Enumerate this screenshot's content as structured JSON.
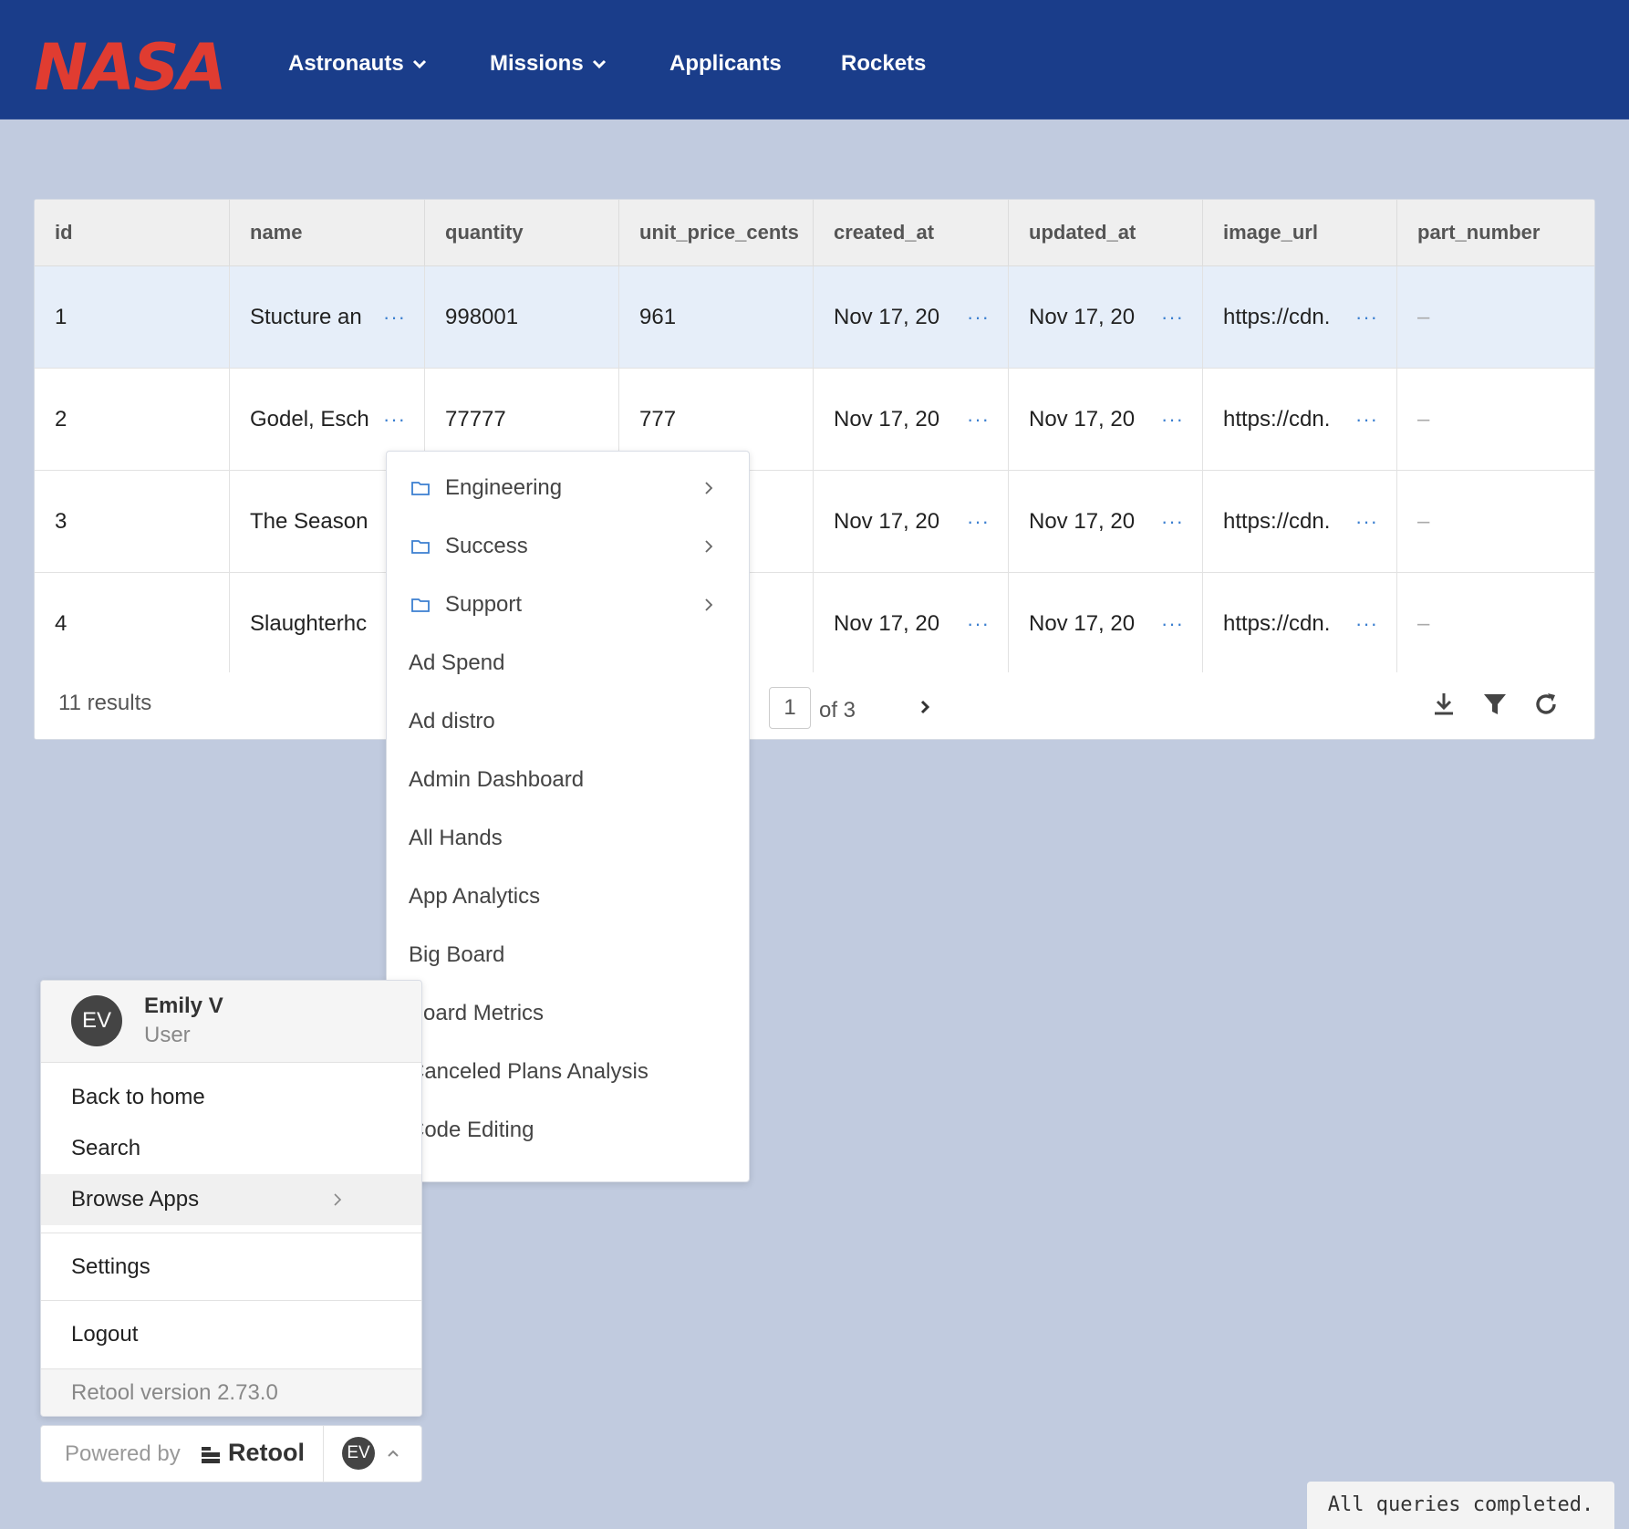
{
  "brand": {
    "logo_text": "NASA",
    "logo_color": "#e03c31",
    "nav_bg": "#1a3d8a"
  },
  "nav": {
    "items": [
      {
        "label": "Astronauts",
        "dropdown": true
      },
      {
        "label": "Missions",
        "dropdown": true
      },
      {
        "label": "Applicants",
        "dropdown": false
      },
      {
        "label": "Rockets",
        "dropdown": false
      }
    ]
  },
  "table": {
    "columns": [
      "id",
      "name",
      "quantity",
      "unit_price_cents",
      "created_at",
      "updated_at",
      "image_url",
      "part_number"
    ],
    "rows": [
      {
        "id": "1",
        "name": "Stucture an",
        "quantity": "998001",
        "unit_price_cents": "961",
        "created_at": "Nov 17, 20",
        "updated_at": "Nov 17, 20",
        "image_url": "https://cdn.",
        "part_number": "–"
      },
      {
        "id": "2",
        "name": "Godel, Esch",
        "quantity": "77777",
        "unit_price_cents": "777",
        "created_at": "Nov 17, 20",
        "updated_at": "Nov 17, 20",
        "image_url": "https://cdn.",
        "part_number": "–"
      },
      {
        "id": "3",
        "name": "The Season",
        "quantity": "",
        "unit_price_cents": "",
        "created_at": "Nov 17, 20",
        "updated_at": "Nov 17, 20",
        "image_url": "https://cdn.",
        "part_number": "–"
      },
      {
        "id": "4",
        "name": "Slaughterhc",
        "quantity": "",
        "unit_price_cents": "",
        "created_at": "Nov 17, 20",
        "updated_at": "Nov 17, 20",
        "image_url": "https://cdn.",
        "part_number": "–"
      }
    ],
    "more_indicator": "···",
    "results_label": "11 results",
    "pagination": {
      "page": "1",
      "of_label": "of 3"
    },
    "toolbar_icons": [
      "download-icon",
      "filter-icon",
      "refresh-icon"
    ]
  },
  "apps_menu": {
    "folders": [
      "Engineering",
      "Success",
      "Support"
    ],
    "apps": [
      "Ad Spend",
      "Ad distro",
      "Admin Dashboard",
      "All Hands",
      "App Analytics",
      "Big Board",
      "Board Metrics",
      "Canceled Plans Analysis",
      "Code Editing"
    ]
  },
  "user_menu": {
    "initials": "EV",
    "name": "Emily V",
    "role": "User",
    "items": {
      "back_home": "Back to home",
      "search": "Search",
      "browse_apps": "Browse Apps",
      "settings": "Settings",
      "logout": "Logout"
    },
    "version": "Retool version 2.73.0"
  },
  "powered_by": {
    "prefix": "Powered by",
    "brand": "Retool",
    "initials": "EV"
  },
  "status": "All queries completed."
}
